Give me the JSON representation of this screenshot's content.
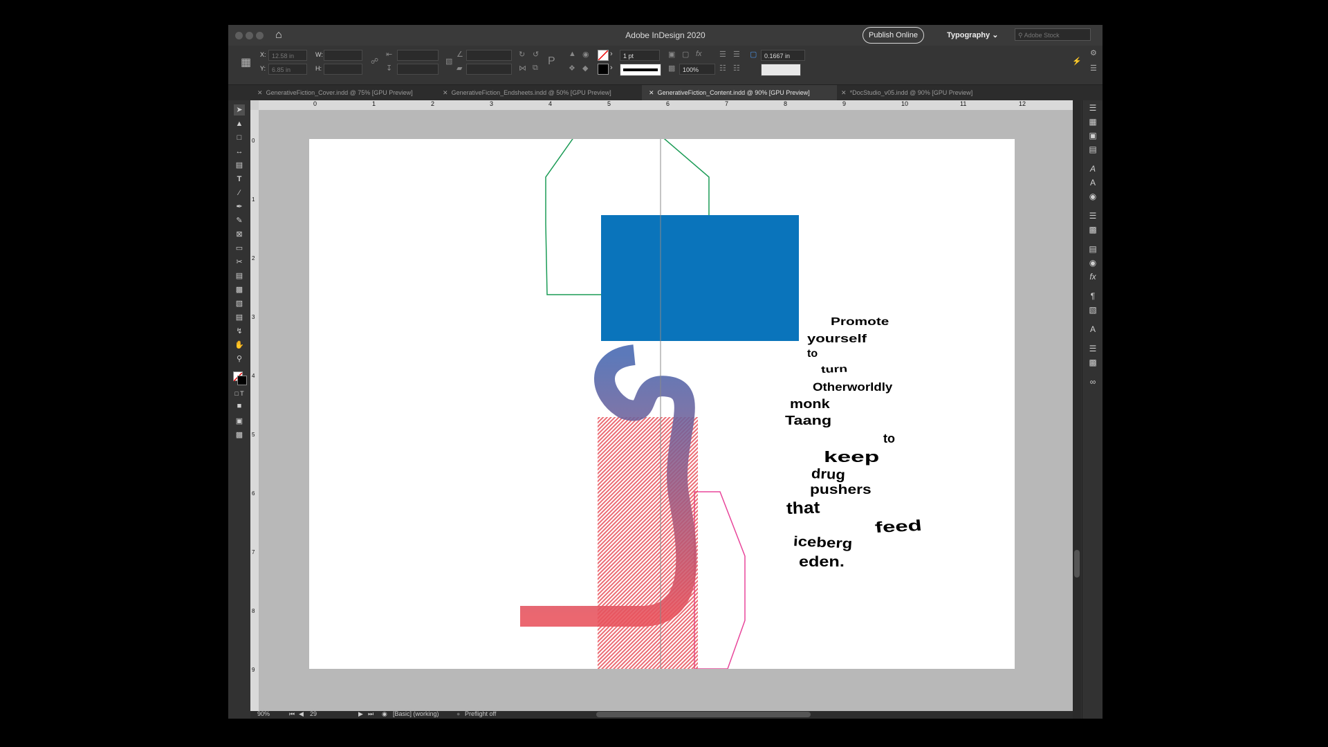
{
  "app": {
    "title": "Adobe InDesign 2020",
    "publish_label": "Publish Online",
    "workspace_label": "Typography",
    "stock_placeholder": "Adobe Stock"
  },
  "control": {
    "x_label": "X:",
    "x_value": "12.58 in",
    "y_label": "Y:",
    "y_value": "6.85 in",
    "w_label": "W:",
    "h_label": "H:",
    "stroke_weight": "1 pt",
    "scale": "100%",
    "gap": "0.1667 in"
  },
  "tabs": [
    "GenerativeFiction_Cover.indd @ 75% [GPU Preview]",
    "GenerativeFiction_Endsheets.indd @ 50% [GPU Preview]",
    "GenerativeFiction_Content.indd @ 90% [GPU Preview]",
    "*DocStudio_v05.indd @ 90% [GPU Preview]"
  ],
  "ruler": {
    "h": [
      "0",
      "1",
      "2",
      "3",
      "4",
      "5",
      "6",
      "7",
      "8",
      "9",
      "10",
      "11",
      "12"
    ],
    "v": [
      "0",
      "1",
      "2",
      "3",
      "4",
      "5",
      "6",
      "7",
      "8",
      "9"
    ]
  },
  "page_text": [
    "Promote",
    "yourself",
    "to",
    "turn",
    "Otherworldly",
    "monk",
    "Taang",
    "to",
    "keep",
    "drug",
    "pushers",
    "that",
    "feed",
    "iceberg",
    "eden."
  ],
  "status": {
    "zoom": "90%",
    "page": "29",
    "profile": "[Basic] (working)",
    "preflight": "Preflight off"
  },
  "colors": {
    "rect": "#0a74bb",
    "octagon": "#1a9b55",
    "pink_outline": "#e8459a",
    "gradient_blue": "#4667b0",
    "gradient_red": "#e8525c"
  }
}
